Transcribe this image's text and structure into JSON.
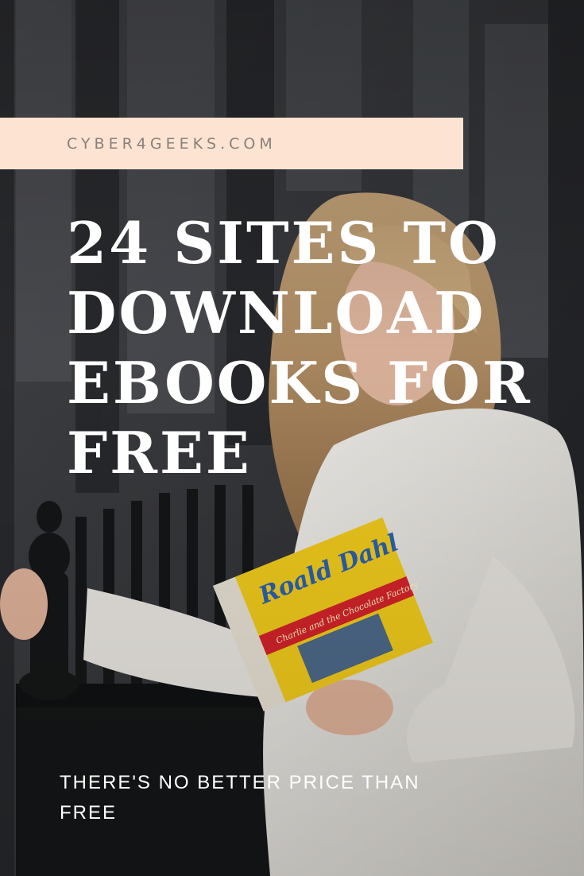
{
  "site": {
    "name": "CYBER4GEEKS.COM"
  },
  "headline": {
    "lines": [
      "24 SITES TO",
      "DOWNLOAD",
      "EBOOKS FOR",
      "FREE"
    ]
  },
  "tagline": {
    "text": "THERE'S NO BETTER PRICE THAN FREE"
  },
  "book": {
    "author": "Roald Dahl",
    "title": "Charlie and the Chocolate Factory"
  },
  "colors": {
    "banner": "#fde4d2",
    "banner_text": "#8a7f7a",
    "headline": "#ffffff"
  }
}
